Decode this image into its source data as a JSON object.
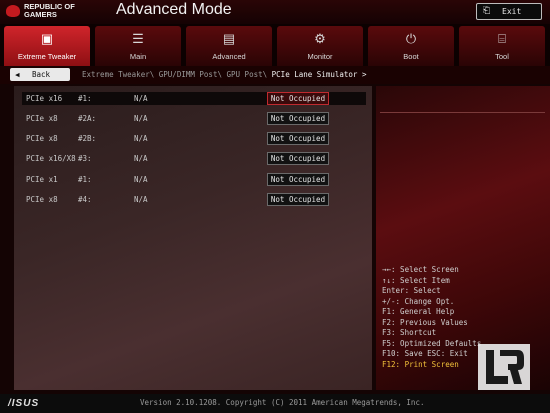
{
  "header": {
    "brand_line1": "REPUBLIC OF",
    "brand_line2": "GAMERS",
    "mode_title": "Advanced Mode",
    "exit_label": "Exit",
    "exit_icon": "exit-icon"
  },
  "tabs": [
    {
      "label": "Extreme Tweaker",
      "icon": "tweaker-icon",
      "active": true
    },
    {
      "label": "Main",
      "icon": "list-icon",
      "active": false
    },
    {
      "label": "Advanced",
      "icon": "advanced-icon",
      "active": false
    },
    {
      "label": "Monitor",
      "icon": "monitor-icon",
      "active": false
    },
    {
      "label": "Boot",
      "icon": "power-icon",
      "active": false
    },
    {
      "label": "Tool",
      "icon": "tool-icon",
      "active": false
    }
  ],
  "breadcrumb": {
    "back_label": "Back",
    "path": "Extreme Tweaker\\ GPU/DIMM Post\\ GPU Post\\",
    "current": "PCIe Lane Simulator >"
  },
  "rows": [
    {
      "slot": "PCIe x16",
      "lane": "#1:",
      "value": "N/A",
      "status": "Not Occupied",
      "selected": true
    },
    {
      "slot": "PCIe x8",
      "lane": "#2A:",
      "value": "N/A",
      "status": "Not Occupied",
      "selected": false
    },
    {
      "slot": "PCIe x8",
      "lane": "#2B:",
      "value": "N/A",
      "status": "Not Occupied",
      "selected": false
    },
    {
      "slot": "PCIe x16/X8",
      "lane": "#3:",
      "value": "N/A",
      "status": "Not Occupied",
      "selected": false
    },
    {
      "slot": "PCIe x1",
      "lane": "#1:",
      "value": "N/A",
      "status": "Not Occupied",
      "selected": false
    },
    {
      "slot": "PCIe x8",
      "lane": "#4:",
      "value": "N/A",
      "status": "Not Occupied",
      "selected": false
    }
  ],
  "help": [
    "→←: Select Screen",
    "↑↓: Select Item",
    "Enter: Select",
    "+/-: Change Opt.",
    "F1: General Help",
    "F2: Previous Values",
    "F3: Shortcut",
    "F5: Optimized Defaults",
    "F10: Save  ESC: Exit",
    "F12: Print Screen"
  ],
  "footer": {
    "brand": "/ISUS",
    "version": "Version 2.10.1208. Copyright (C) 2011 American Megatrends, Inc."
  },
  "colors": {
    "accent": "#c8232a",
    "highlight": "#f2c23a"
  }
}
